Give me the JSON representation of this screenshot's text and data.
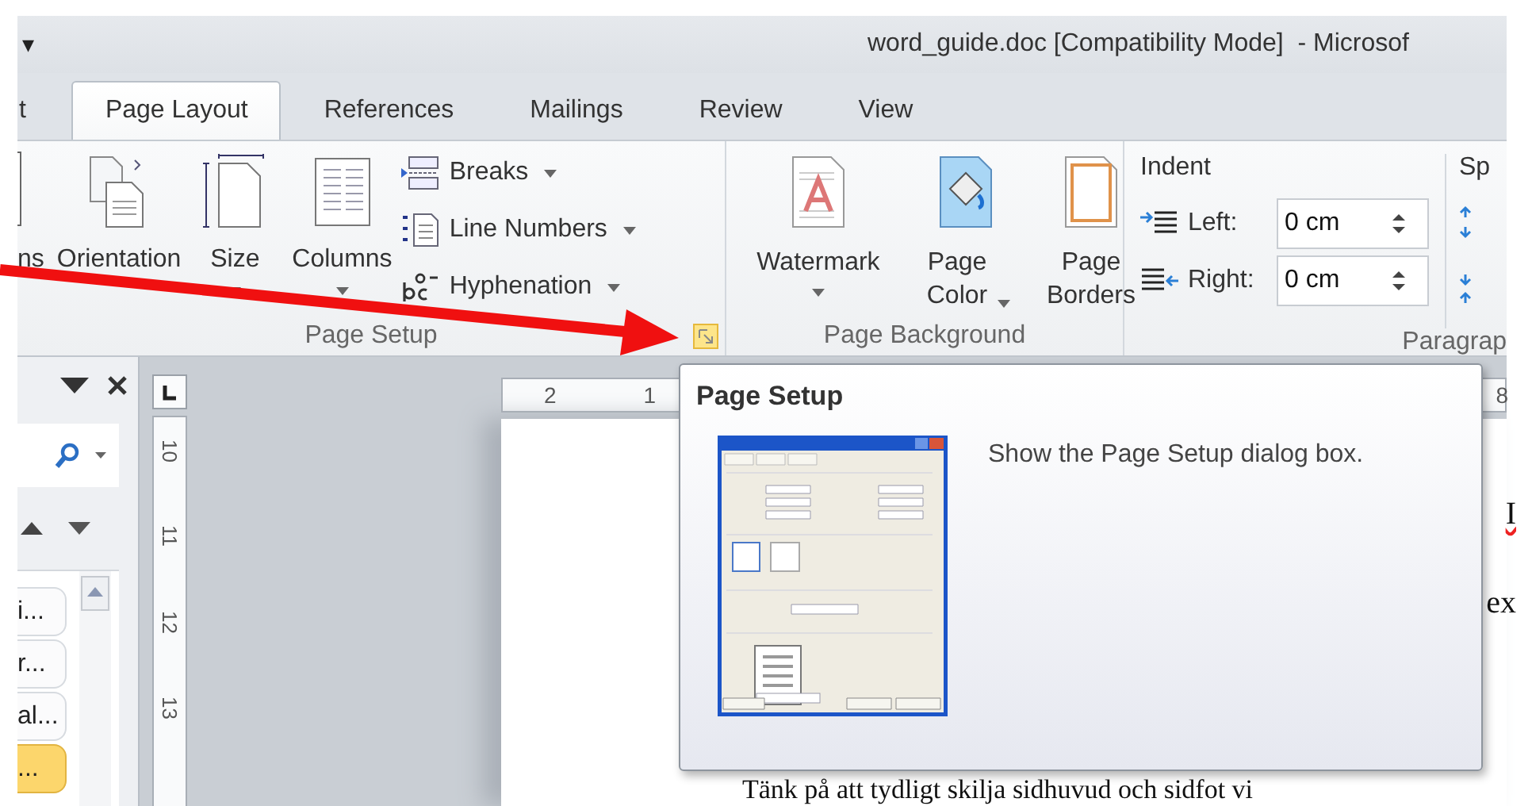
{
  "window": {
    "quick_access": "▾",
    "title": "word_guide.doc [Compatibility Mode]  - Microsof"
  },
  "tabs": [
    {
      "label": "t",
      "selected": false
    },
    {
      "label": "Page Layout",
      "selected": true
    },
    {
      "label": "References",
      "selected": false
    },
    {
      "label": "Mailings",
      "selected": false
    },
    {
      "label": "Review",
      "selected": false
    },
    {
      "label": "View",
      "selected": false
    }
  ],
  "page_setup": {
    "label": "Page Setup",
    "launcher_highlighted": true,
    "large_buttons": [
      {
        "label": "ns",
        "dropdown": false
      },
      {
        "label": "Orientation",
        "dropdown": false
      },
      {
        "label": "Size",
        "dropdown": true
      },
      {
        "label": "Columns",
        "dropdown": true
      }
    ],
    "small_buttons": [
      {
        "label": "Breaks",
        "dropdown": true
      },
      {
        "label": "Line Numbers",
        "dropdown": true
      },
      {
        "label": "Hyphenation",
        "dropdown": true
      }
    ]
  },
  "page_background": {
    "label": "Page Background",
    "buttons": [
      {
        "label": "Watermark",
        "dropdown": true
      },
      {
        "label": "Page Color",
        "dropdown": true
      },
      {
        "label": "Page Borders",
        "dropdown": false
      }
    ]
  },
  "paragraph": {
    "label": "Paragrap",
    "indent_label": "Indent",
    "spacing_label": "Sp",
    "fields": [
      {
        "label": "Left:",
        "value": "0 cm"
      },
      {
        "label": "Right:",
        "value": "0 cm"
      }
    ]
  },
  "nav_pane": {
    "items": [
      {
        "label": "i...",
        "selected": false
      },
      {
        "label": "r...",
        "selected": false
      },
      {
        "label": "al...",
        "selected": false
      },
      {
        "label": "...",
        "selected": true
      }
    ]
  },
  "rulers": {
    "vertical": [
      "10",
      "11",
      "12",
      "13"
    ],
    "horizontal": [
      "2",
      "1",
      "8"
    ]
  },
  "document": {
    "fragments": [
      {
        "text": "I",
        "misspelled": true
      },
      {
        "text": "ex",
        "misspelled": false
      }
    ],
    "sentence": "Tänk på att tydligt skilja sidhuvud och sidfot vi"
  },
  "tooltip": {
    "title": "Page Setup",
    "description": "Show the Page Setup dialog box."
  }
}
